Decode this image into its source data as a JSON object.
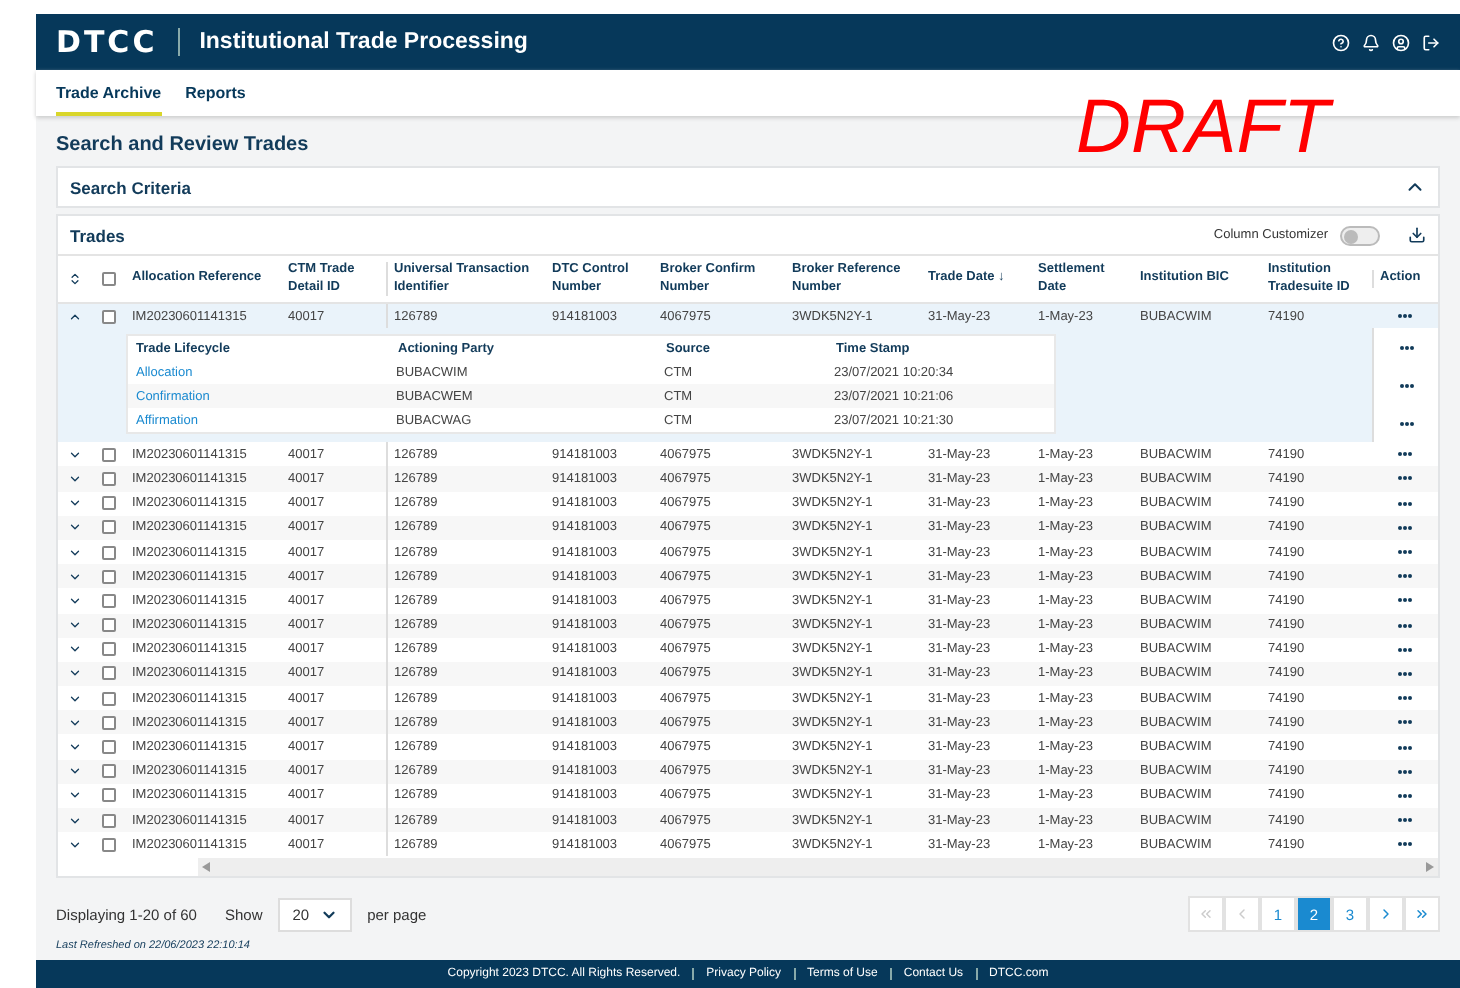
{
  "header": {
    "logo": "DTCC",
    "title": "Institutional Trade Processing"
  },
  "nav_tabs": [
    {
      "label": "Trade Archive",
      "selected": true
    },
    {
      "label": "Reports",
      "selected": false
    }
  ],
  "stamp": "DRAFT",
  "page_title": "Search and Review Trades",
  "search_criteria": {
    "title": "Search Criteria",
    "expanded": true
  },
  "trades": {
    "title": "Trades",
    "select_all_checked": false,
    "column_customizer": {
      "label": "Column Customizer",
      "on": false
    },
    "columns": [
      "Allocation Reference",
      "CTM Trade Detail ID",
      "Universal Transaction Identifier",
      "DTC Control Number",
      "Broker Confirm Number",
      "Broker Reference Number",
      "Trade Date ↓",
      "Settlement Date",
      "Institution BIC",
      "Institution Tradesuite ID",
      "Action"
    ],
    "rows": [
      {
        "expanded": true,
        "checked": false,
        "cells": [
          "IM20230601141315",
          "40017",
          "126789",
          "914181003",
          "4067975",
          "3WDK5N2Y-1",
          "31-May-23",
          "1-May-23",
          "BUBACWIM",
          "74190"
        ],
        "lifecycle": {
          "columns": [
            "Trade Lifecycle",
            "Actioning Party",
            "Source",
            "Time Stamp"
          ],
          "items": [
            {
              "stage": "Allocation",
              "party": "BUBACWIM",
              "source": "CTM",
              "time": "23/07/2021 10:20:34"
            },
            {
              "stage": "Confirmation",
              "party": "BUBACWEM",
              "source": "CTM",
              "time": "23/07/2021 10:21:06"
            },
            {
              "stage": "Affirmation",
              "party": "BUBACWAG",
              "source": "CTM",
              "time": "23/07/2021 10:21:30"
            }
          ]
        }
      },
      {
        "expanded": false,
        "checked": false,
        "cells": [
          "IM20230601141315",
          "40017",
          "126789",
          "914181003",
          "4067975",
          "3WDK5N2Y-1",
          "31-May-23",
          "1-May-23",
          "BUBACWIM",
          "74190"
        ]
      },
      {
        "expanded": false,
        "checked": false,
        "cells": [
          "IM20230601141315",
          "40017",
          "126789",
          "914181003",
          "4067975",
          "3WDK5N2Y-1",
          "31-May-23",
          "1-May-23",
          "BUBACWIM",
          "74190"
        ]
      },
      {
        "expanded": false,
        "checked": false,
        "cells": [
          "IM20230601141315",
          "40017",
          "126789",
          "914181003",
          "4067975",
          "3WDK5N2Y-1",
          "31-May-23",
          "1-May-23",
          "BUBACWIM",
          "74190"
        ]
      },
      {
        "expanded": false,
        "checked": false,
        "cells": [
          "IM20230601141315",
          "40017",
          "126789",
          "914181003",
          "4067975",
          "3WDK5N2Y-1",
          "31-May-23",
          "1-May-23",
          "BUBACWIM",
          "74190"
        ]
      },
      {
        "expanded": false,
        "checked": false,
        "cells": [
          "IM20230601141315",
          "40017",
          "126789",
          "914181003",
          "4067975",
          "3WDK5N2Y-1",
          "31-May-23",
          "1-May-23",
          "BUBACWIM",
          "74190"
        ]
      },
      {
        "expanded": false,
        "checked": false,
        "cells": [
          "IM20230601141315",
          "40017",
          "126789",
          "914181003",
          "4067975",
          "3WDK5N2Y-1",
          "31-May-23",
          "1-May-23",
          "BUBACWIM",
          "74190"
        ]
      },
      {
        "expanded": false,
        "checked": false,
        "cells": [
          "IM20230601141315",
          "40017",
          "126789",
          "914181003",
          "4067975",
          "3WDK5N2Y-1",
          "31-May-23",
          "1-May-23",
          "BUBACWIM",
          "74190"
        ]
      },
      {
        "expanded": false,
        "checked": false,
        "cells": [
          "IM20230601141315",
          "40017",
          "126789",
          "914181003",
          "4067975",
          "3WDK5N2Y-1",
          "31-May-23",
          "1-May-23",
          "BUBACWIM",
          "74190"
        ]
      },
      {
        "expanded": false,
        "checked": false,
        "cells": [
          "IM20230601141315",
          "40017",
          "126789",
          "914181003",
          "4067975",
          "3WDK5N2Y-1",
          "31-May-23",
          "1-May-23",
          "BUBACWIM",
          "74190"
        ]
      },
      {
        "expanded": false,
        "checked": false,
        "cells": [
          "IM20230601141315",
          "40017",
          "126789",
          "914181003",
          "4067975",
          "3WDK5N2Y-1",
          "31-May-23",
          "1-May-23",
          "BUBACWIM",
          "74190"
        ]
      },
      {
        "expanded": false,
        "checked": false,
        "cells": [
          "IM20230601141315",
          "40017",
          "126789",
          "914181003",
          "4067975",
          "3WDK5N2Y-1",
          "31-May-23",
          "1-May-23",
          "BUBACWIM",
          "74190"
        ]
      },
      {
        "expanded": false,
        "checked": false,
        "cells": [
          "IM20230601141315",
          "40017",
          "126789",
          "914181003",
          "4067975",
          "3WDK5N2Y-1",
          "31-May-23",
          "1-May-23",
          "BUBACWIM",
          "74190"
        ]
      },
      {
        "expanded": false,
        "checked": false,
        "cells": [
          "IM20230601141315",
          "40017",
          "126789",
          "914181003",
          "4067975",
          "3WDK5N2Y-1",
          "31-May-23",
          "1-May-23",
          "BUBACWIM",
          "74190"
        ]
      },
      {
        "expanded": false,
        "checked": false,
        "cells": [
          "IM20230601141315",
          "40017",
          "126789",
          "914181003",
          "4067975",
          "3WDK5N2Y-1",
          "31-May-23",
          "1-May-23",
          "BUBACWIM",
          "74190"
        ]
      },
      {
        "expanded": false,
        "checked": false,
        "cells": [
          "IM20230601141315",
          "40017",
          "126789",
          "914181003",
          "4067975",
          "3WDK5N2Y-1",
          "31-May-23",
          "1-May-23",
          "BUBACWIM",
          "74190"
        ]
      },
      {
        "expanded": false,
        "checked": false,
        "cells": [
          "IM20230601141315",
          "40017",
          "126789",
          "914181003",
          "4067975",
          "3WDK5N2Y-1",
          "31-May-23",
          "1-May-23",
          "BUBACWIM",
          "74190"
        ]
      },
      {
        "expanded": false,
        "checked": false,
        "cells": [
          "IM20230601141315",
          "40017",
          "126789",
          "914181003",
          "4067975",
          "3WDK5N2Y-1",
          "31-May-23",
          "1-May-23",
          "BUBACWIM",
          "74190"
        ]
      }
    ]
  },
  "pagination": {
    "summary": "Displaying 1-20 of 60",
    "show_label": "Show",
    "page_size": "20",
    "per_page_label": "per page",
    "last_refreshed": "Last Refreshed on 22/06/2023 22:10:14",
    "pages": [
      {
        "label": "1",
        "selected": false
      },
      {
        "label": "2",
        "selected": true
      },
      {
        "label": "3",
        "selected": false
      }
    ]
  },
  "footer": {
    "copyright": "Copyright 2023 DTCC. All Rights Reserved.",
    "links": [
      "Privacy Policy",
      "Terms of Use",
      "Contact Us",
      "DTCC.com"
    ]
  }
}
